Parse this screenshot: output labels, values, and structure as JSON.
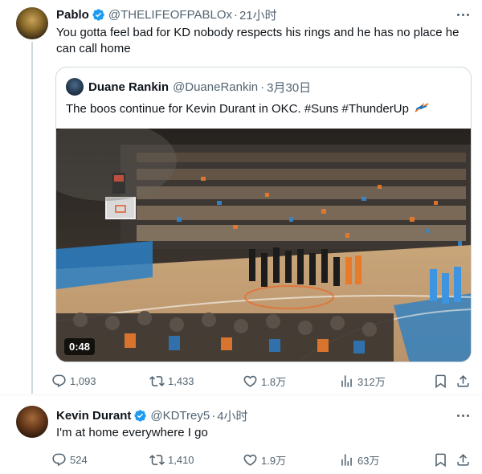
{
  "tweet1": {
    "author_name": "Pablo",
    "handle": "@THELIFEOFPABLOx",
    "separator": "·",
    "time": "21小时",
    "text_line1": "You gotta feel bad for KD nobody respects his rings and he has no place he",
    "text_line2": "can call home",
    "quote": {
      "author_name": "Duane Rankin",
      "handle": "@DuaneRankin",
      "separator": "·",
      "time": "3月30日",
      "text": "The boos continue for Kevin Durant in OKC. #Suns #ThunderUp",
      "video_duration": "0:48"
    },
    "actions": {
      "replies": "1,093",
      "reposts": "1,433",
      "likes": "1.8万",
      "views": "312万"
    }
  },
  "tweet2": {
    "author_name": "Kevin Durant",
    "handle": "@KDTrey5",
    "separator": "·",
    "time": "4小时",
    "text": "I'm at home everywhere I go",
    "actions": {
      "replies": "524",
      "reposts": "1,410",
      "likes": "1.9万",
      "views": "63万"
    }
  },
  "colors": {
    "verified": "#1d9bf0",
    "text_primary": "#0f1419",
    "text_secondary": "#536471",
    "border": "#cfd9de"
  }
}
